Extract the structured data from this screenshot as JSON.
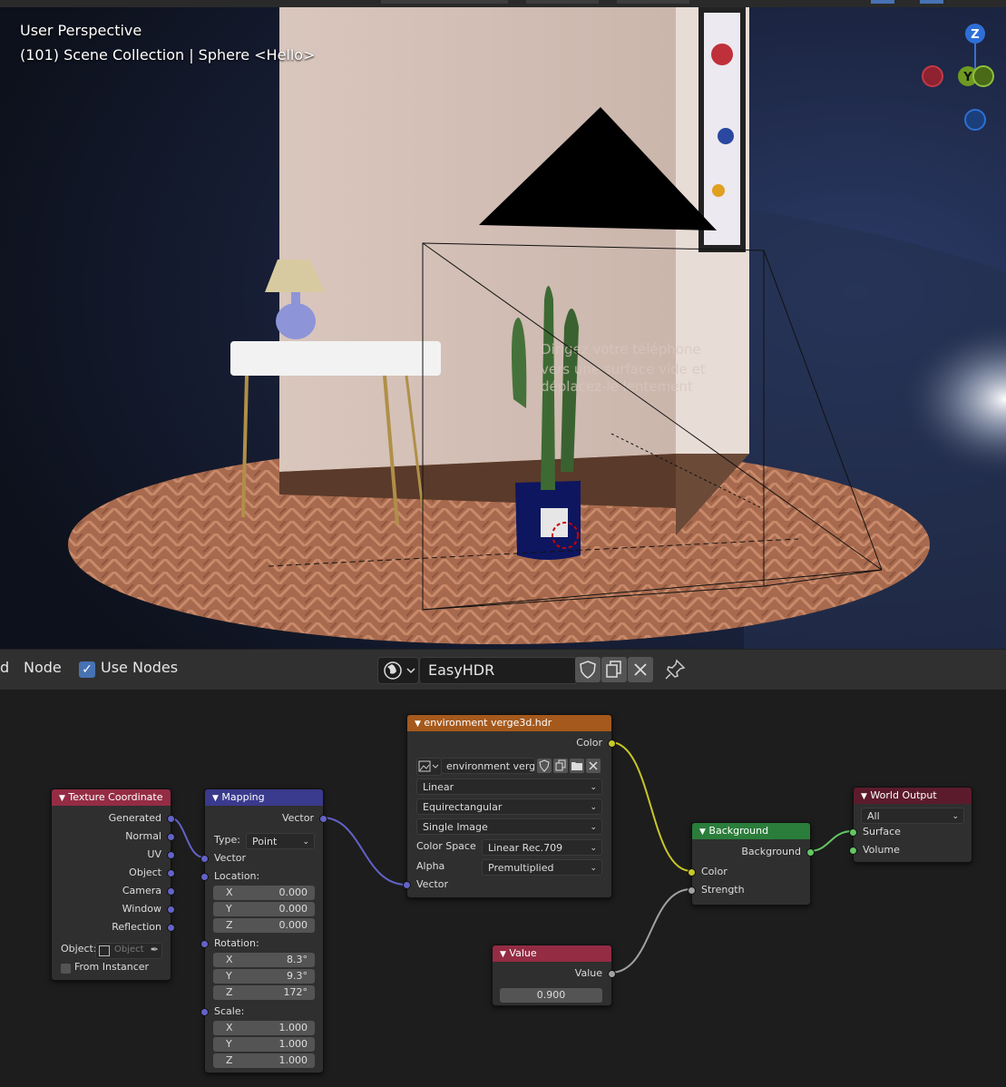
{
  "viewport": {
    "mode_label": "User Perspective",
    "collection_label": "(101) Scene Collection | Sphere <Hello>",
    "gizmo": {
      "z_label": "Z",
      "y_label": "Y"
    },
    "ar_overlay_text": [
      "Dirigez votre téléphone",
      "vers une surface vide et",
      "déplacez-le lentement"
    ]
  },
  "header": {
    "menu_partial": "d",
    "node_menu": "Node",
    "use_nodes_label": "Use Nodes",
    "use_nodes_checked": "✓",
    "world_name": "EasyHDR"
  },
  "nodes": {
    "texcoord": {
      "title": "Texture Coordinate",
      "outputs": [
        "Generated",
        "Normal",
        "UV",
        "Object",
        "Camera",
        "Window",
        "Reflection"
      ],
      "object_label": "Object:",
      "object_placeholder": "Object",
      "from_instancer": "From Instancer"
    },
    "mapping": {
      "title": "Mapping",
      "output": "Vector",
      "type_label": "Type:",
      "type_value": "Point",
      "vector_input": "Vector",
      "location_label": "Location:",
      "location": [
        {
          "axis": "X",
          "value": "0.000"
        },
        {
          "axis": "Y",
          "value": "0.000"
        },
        {
          "axis": "Z",
          "value": "0.000"
        }
      ],
      "rotation_label": "Rotation:",
      "rotation": [
        {
          "axis": "X",
          "value": "8.3°"
        },
        {
          "axis": "Y",
          "value": "9.3°"
        },
        {
          "axis": "Z",
          "value": "172°"
        }
      ],
      "scale_label": "Scale:",
      "scale": [
        {
          "axis": "X",
          "value": "1.000"
        },
        {
          "axis": "Y",
          "value": "1.000"
        },
        {
          "axis": "Z",
          "value": "1.000"
        }
      ]
    },
    "envtex": {
      "title": "environment verge3d.hdr",
      "output": "Color",
      "image_name": "environment verg...",
      "interpolation": "Linear",
      "projection": "Equirectangular",
      "source": "Single Image",
      "color_space_label": "Color Space",
      "color_space": "Linear Rec.709",
      "alpha_label": "Alpha",
      "alpha": "Premultiplied",
      "vector_input": "Vector"
    },
    "value": {
      "title": "Value",
      "output": "Value",
      "value": "0.900"
    },
    "background": {
      "title": "Background",
      "output": "Background",
      "color_input": "Color",
      "strength_input": "Strength"
    },
    "world_output": {
      "title": "World Output",
      "target": "All",
      "surface_input": "Surface",
      "volume_input": "Volume"
    }
  },
  "colors": {
    "header_input": "#942c44",
    "header_vector": "#3a3a8e",
    "header_texture": "#a5591c",
    "header_shader": "#2a7d3a",
    "header_output": "#5c1b2c",
    "socket_vector": "#6363c7",
    "socket_color": "#c7c729",
    "socket_float": "#a1a1a1",
    "socket_shader": "#63c763",
    "checkbox_blue": "#4772b3"
  }
}
